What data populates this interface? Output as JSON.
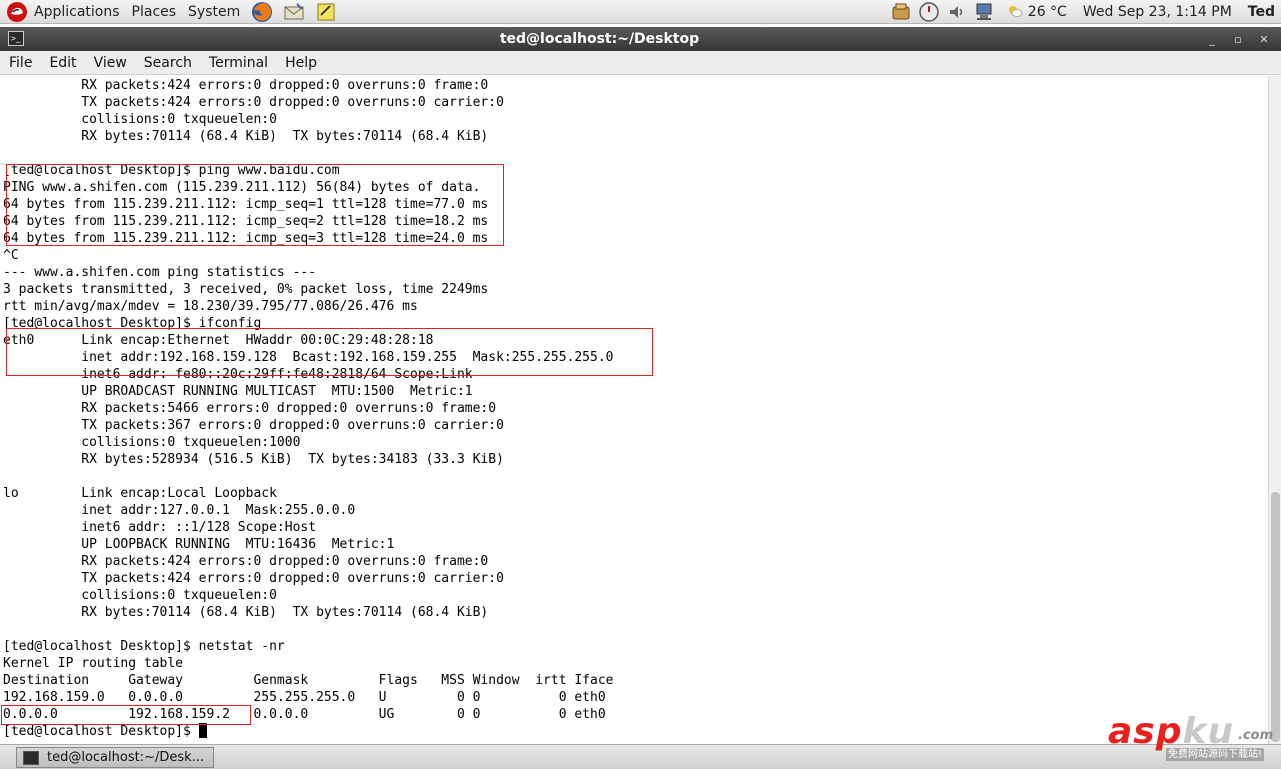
{
  "top_panel": {
    "applications": "Applications",
    "places": "Places",
    "system": "System",
    "launchers": [
      "firefox-icon",
      "mail-icon",
      "notes-icon"
    ],
    "tray": [
      "updates-icon",
      "power-icon",
      "volume-icon",
      "network-icon"
    ],
    "weather": "26 °C",
    "clock": "Wed Sep 23,  1:14 PM",
    "user": "Ted"
  },
  "window": {
    "title": "ted@localhost:~/Desktop",
    "controls": [
      "_",
      "▫",
      "✕"
    ]
  },
  "menu": [
    "File",
    "Edit",
    "View",
    "Search",
    "Terminal",
    "Help"
  ],
  "terminal_lines": [
    "          RX packets:424 errors:0 dropped:0 overruns:0 frame:0",
    "          TX packets:424 errors:0 dropped:0 overruns:0 carrier:0",
    "          collisions:0 txqueuelen:0",
    "          RX bytes:70114 (68.4 KiB)  TX bytes:70114 (68.4 KiB)",
    "",
    "[ted@localhost Desktop]$ ping www.baidu.com",
    "PING www.a.shifen.com (115.239.211.112) 56(84) bytes of data.",
    "64 bytes from 115.239.211.112: icmp_seq=1 ttl=128 time=77.0 ms",
    "64 bytes from 115.239.211.112: icmp_seq=2 ttl=128 time=18.2 ms",
    "64 bytes from 115.239.211.112: icmp_seq=3 ttl=128 time=24.0 ms",
    "^C",
    "--- www.a.shifen.com ping statistics ---",
    "3 packets transmitted, 3 received, 0% packet loss, time 2249ms",
    "rtt min/avg/max/mdev = 18.230/39.795/77.086/26.476 ms",
    "[ted@localhost Desktop]$ ifconfig",
    "eth0      Link encap:Ethernet  HWaddr 00:0C:29:48:28:18",
    "          inet addr:192.168.159.128  Bcast:192.168.159.255  Mask:255.255.255.0",
    "          inet6 addr: fe80::20c:29ff:fe48:2818/64 Scope:Link",
    "          UP BROADCAST RUNNING MULTICAST  MTU:1500  Metric:1",
    "          RX packets:5466 errors:0 dropped:0 overruns:0 frame:0",
    "          TX packets:367 errors:0 dropped:0 overruns:0 carrier:0",
    "          collisions:0 txqueuelen:1000",
    "          RX bytes:528934 (516.5 KiB)  TX bytes:34183 (33.3 KiB)",
    "",
    "lo        Link encap:Local Loopback",
    "          inet addr:127.0.0.1  Mask:255.0.0.0",
    "          inet6 addr: ::1/128 Scope:Host",
    "          UP LOOPBACK RUNNING  MTU:16436  Metric:1",
    "          RX packets:424 errors:0 dropped:0 overruns:0 frame:0",
    "          TX packets:424 errors:0 dropped:0 overruns:0 carrier:0",
    "          collisions:0 txqueuelen:0",
    "          RX bytes:70114 (68.4 KiB)  TX bytes:70114 (68.4 KiB)",
    "",
    "[ted@localhost Desktop]$ netstat -nr",
    "Kernel IP routing table",
    "Destination     Gateway         Genmask         Flags   MSS Window  irtt Iface",
    "192.168.159.0   0.0.0.0         255.255.255.0   U         0 0          0 eth0",
    "0.0.0.0         192.168.159.2   0.0.0.0         UG        0 0          0 eth0",
    "[ted@localhost Desktop]$ "
  ],
  "taskbar": {
    "task_label": "ted@localhost:~/Desk..."
  },
  "watermark": {
    "brand_asp": "asp",
    "brand_ku": "ku",
    "brand_com": ".com",
    "tagline": "免费网站源码下载站!"
  },
  "colors": {
    "highlight_box": "#dd2222",
    "titlebar": "#3c3c3c",
    "watermark_red": "#e8211c"
  }
}
